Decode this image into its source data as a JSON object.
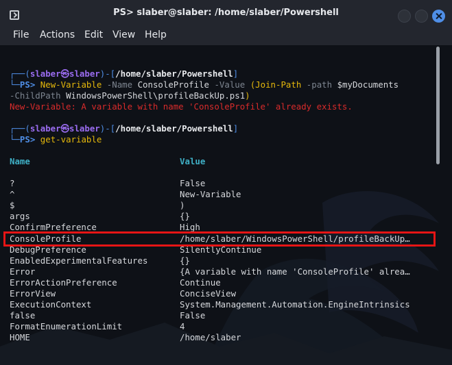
{
  "window": {
    "title": "PS> slaber@slaber: /home/slaber/Powershell"
  },
  "menu": [
    "File",
    "Actions",
    "Edit",
    "View",
    "Help"
  ],
  "prompts": [
    {
      "corner_top": "┌──(",
      "user": "slaber",
      "at": "㉿",
      "host": "slaber",
      "mid": ")-[",
      "path": "/home/slaber/Powershell",
      "end": "]",
      "corner_bottom": "└─",
      "ps": "PS>",
      "command": "New-Variable",
      "param1": "-Name",
      "arg1": "ConsoleProfile",
      "param2": "-Value",
      "paren_open": "(",
      "cmd2": "Join-Path",
      "param3": "-path",
      "var": "$myDocuments",
      "param4": "-ChildPath",
      "arg4": "WindowsPowerShell\\profileBackUp.ps1",
      "paren_close": ")"
    },
    {
      "corner_top": "┌──(",
      "user": "slaber",
      "at": "㉿",
      "host": "slaber",
      "mid": ")-[",
      "path": "/home/slaber/Powershell",
      "end": "]",
      "corner_bottom": "└─",
      "ps": "PS>",
      "command": "get-variable"
    }
  ],
  "error_text": "New-Variable: A variable with name 'ConsoleProfile' already exists.",
  "table": {
    "headers": [
      "Name",
      "Value"
    ],
    "rows": [
      [
        "?",
        "False"
      ],
      [
        "^",
        "New-Variable"
      ],
      [
        "$",
        ")"
      ],
      [
        "args",
        "{}"
      ],
      [
        "ConfirmPreference",
        "High"
      ],
      [
        "ConsoleProfile",
        "/home/slaber/WindowsPowerShell/profileBackUp…"
      ],
      [
        "DebugPreference",
        "SilentlyContinue"
      ],
      [
        "EnabledExperimentalFeatures",
        "{}"
      ],
      [
        "Error",
        "{A variable with name 'ConsoleProfile' alrea…"
      ],
      [
        "ErrorActionPreference",
        "Continue"
      ],
      [
        "ErrorView",
        "ConciseView"
      ],
      [
        "ExecutionContext",
        "System.Management.Automation.EngineIntrinsics"
      ],
      [
        "false",
        "False"
      ],
      [
        "FormatEnumerationLimit",
        "4"
      ],
      [
        "HOME",
        "/home/slaber"
      ]
    ]
  },
  "colors": {
    "prompt_blue": "#4f8ee6",
    "prompt_purple": "#9a6cf0",
    "error_red": "#d92b2b",
    "highlight_red": "#e61515",
    "header_cyan": "#3fb0c6"
  }
}
